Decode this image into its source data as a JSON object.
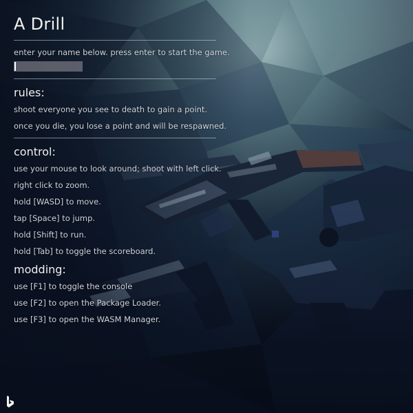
{
  "title": "A Drill",
  "intro": {
    "prompt": "enter your name below. press enter to start the game.",
    "name_value": ""
  },
  "rules": {
    "heading": "rules:",
    "lines": [
      "shoot everyone you see to death to gain a point.",
      "once you die, you lose a point and will be respawned."
    ]
  },
  "control": {
    "heading": "control:",
    "lines": [
      "use your mouse to look around; shoot with left click.",
      "right click to zoom.",
      "hold [WASD] to move.",
      "tap [Space] to jump.",
      "hold [Shift] to run.",
      "hold [Tab] to toggle the scoreboard."
    ]
  },
  "modding": {
    "heading": "modding:",
    "lines": [
      "use [F1] to toggle the console",
      "use [F2] to open the Package Loader.",
      "use [F3] to open the WASM Manager."
    ]
  },
  "colors": {
    "background": "#0c1420",
    "text": "#cfd3da",
    "input_bg": "#78787e"
  },
  "icons": {
    "corner_logo": "bing-logo-icon"
  }
}
